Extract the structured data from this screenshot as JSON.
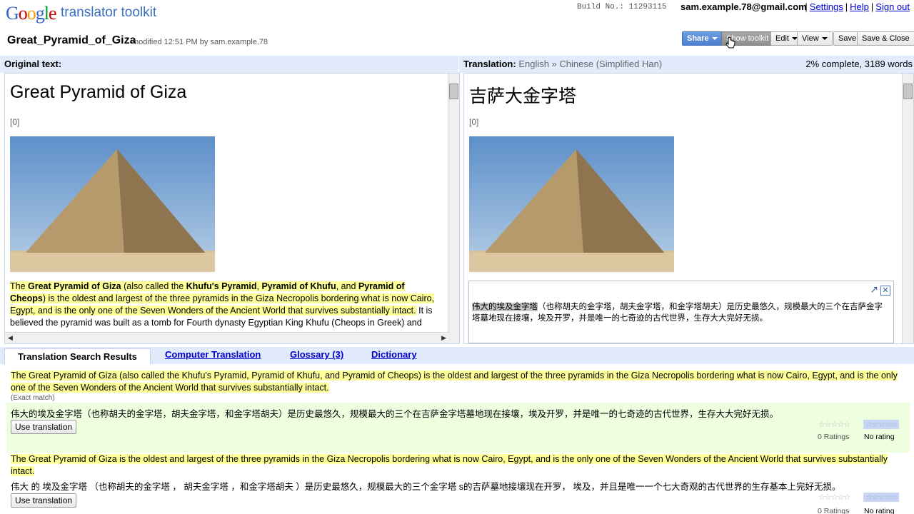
{
  "header": {
    "logo": "Google",
    "product": "translator toolkit",
    "build": "Build No.: 11293115",
    "account": "sam.example.78@gmail.com",
    "links": [
      "Settings",
      "Help",
      "Sign out"
    ]
  },
  "document": {
    "title": "Great_Pyramid_of_Giza",
    "meta": "modified 12:51 PM by sam.example.78"
  },
  "toolbar": {
    "share": "Share",
    "toolkit": "Show toolkit",
    "edit": "Edit",
    "view": "View",
    "save": "Save",
    "save_close": "Save & Close"
  },
  "original": {
    "label": "Original text:",
    "heading": "Great Pyramid of Giza",
    "ref": "[0]",
    "para_parts": {
      "p1": "The ",
      "b1": "Great Pyramid of Giza",
      "p2": " (also called the ",
      "b2": "Khufu's Pyramid",
      "p3": ", ",
      "b3": "Pyramid of Khufu",
      "p4": ", and ",
      "b4": "Pyramid of Cheops",
      "p5": ") is the oldest and largest of the three pyramids in the Giza Necropolis bordering what is now Cairo, Egypt, and is the only one of the Seven Wonders of the Ancient World that survives substantially intact.",
      "p6": " It is believed the pyramid was built as a tomb for Fourth dynasty Egyptian King Khufu (Cheops in Greek) and"
    }
  },
  "translation": {
    "label": "Translation:",
    "languages": "English » Chinese (Simplified Han)",
    "progress": "2% complete,   3189 words",
    "heading": "吉萨大金字塔",
    "ref": "[0]",
    "editor_selected": "伟大的埃及金字塔",
    "editor_rest": "（也称胡夫的金字塔，胡夫金字塔，和金字塔胡夫）是历史最悠久，规模最大的三个在吉萨金字塔墓地现在接壤，埃及开罗，并是唯一的七奇迹的古代世界，生存大大完好无损。"
  },
  "tabs": {
    "search": "Translation Search Results",
    "computer": "Computer Translation",
    "glossary": "Glossary (3)",
    "dictionary": "Dictionary"
  },
  "results": [
    {
      "source": "The Great Pyramid of Giza (also called the Khufu's Pyramid, Pyramid of Khufu, and Pyramid of Cheops) is the oldest and largest of the three pyramids in the Giza Necropolis bordering what is now Cairo, Egypt, and is the only one of the Seven Wonders of the Ancient World that survives substantially intact.",
      "note": "(Exact match)",
      "target": "伟大的埃及金字塔（也称胡夫的金字塔，胡夫金字塔，和金字塔胡夫）是历史最悠久，规模最大的三个在吉萨金字塔墓地现在接壤，埃及开罗，并是唯一的七奇迹的古代世界，生存大大完好无损。",
      "button": "Use translation",
      "ratings": "0 Ratings",
      "rating_status": "No rating"
    },
    {
      "source": "The Great Pyramid of Giza is the oldest and largest of the three pyramids in the Giza Necropolis bordering what is now Cairo, Egypt, and is the only one of the Seven Wonders of the Ancient World that survives substantially intact.",
      "target": "伟大  的  埃及金字塔  （也称胡夫的金字塔  ，  胡夫金字塔  ，和金字塔胡夫  ）是历史最悠久，规模最大的三个金字塔  s的吉萨墓地接壤现在开罗，  埃及，并且是唯一一个七大奇观的古代世界的生存基本上完好无损。",
      "button": "Use translation",
      "ratings": "0 Ratings",
      "rating_status": "No rating"
    }
  ],
  "colors": {
    "pane_header": "#e1ebfb",
    "highlight": "#ffff99",
    "result_band": "#eeffe0",
    "link": "#0000cc"
  }
}
